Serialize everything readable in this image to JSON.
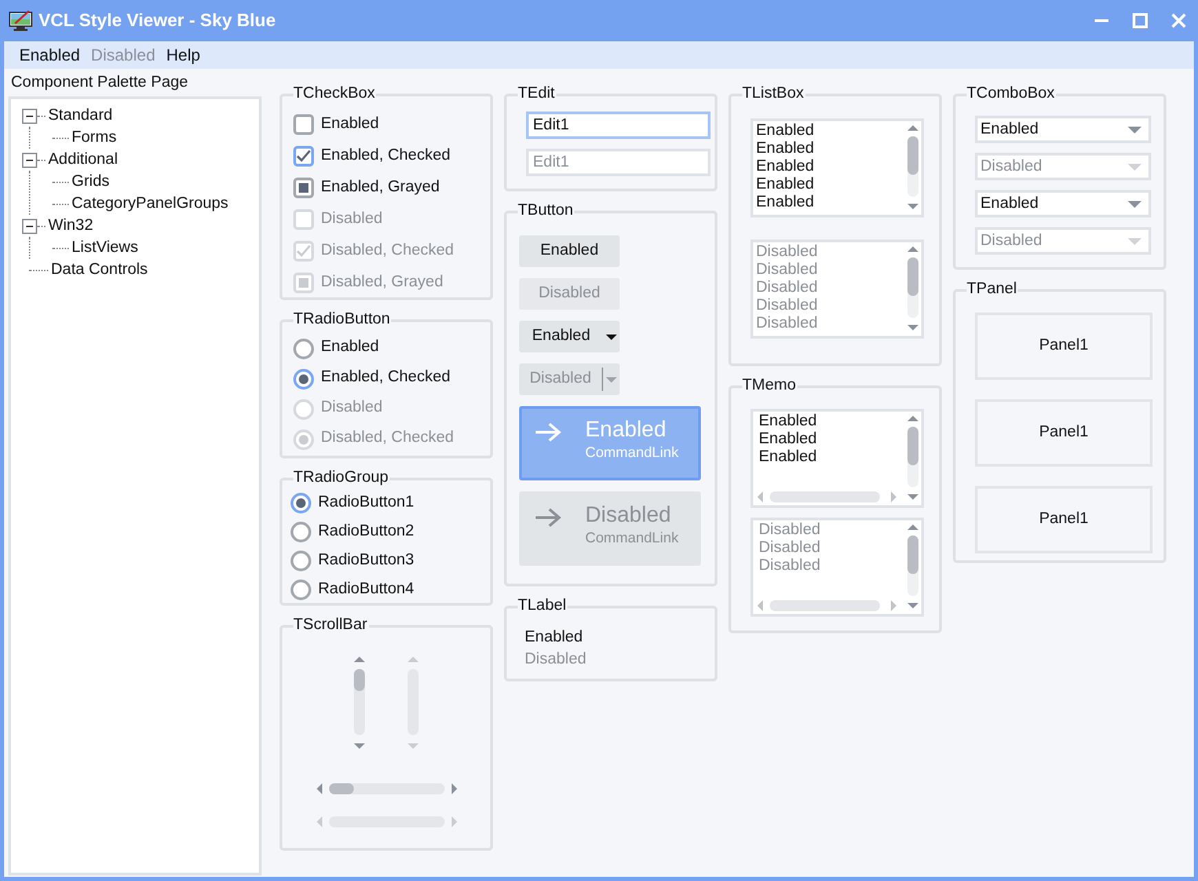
{
  "window": {
    "title": "VCL Style Viewer - Sky Blue"
  },
  "menu": [
    {
      "label": "Enabled",
      "disabled": false
    },
    {
      "label": "Disabled",
      "disabled": true
    },
    {
      "label": "Help",
      "disabled": false
    }
  ],
  "palette": {
    "label": "Component Palette Page",
    "tree": [
      {
        "label": "Standard",
        "expanded": true,
        "children": [
          {
            "label": "Forms"
          }
        ]
      },
      {
        "label": "Additional",
        "expanded": true,
        "children": [
          {
            "label": "Grids"
          },
          {
            "label": "CategoryPanelGroups"
          }
        ]
      },
      {
        "label": "Win32",
        "expanded": true,
        "children": [
          {
            "label": "ListViews"
          }
        ]
      },
      {
        "label": "Data Controls"
      }
    ]
  },
  "checkbox_group": {
    "title": "TCheckBox",
    "items": [
      {
        "label": "Enabled",
        "checked": false,
        "grayed": false,
        "disabled": false
      },
      {
        "label": "Enabled, Checked",
        "checked": true,
        "grayed": false,
        "disabled": false
      },
      {
        "label": "Enabled, Grayed",
        "checked": false,
        "grayed": true,
        "disabled": false
      },
      {
        "label": "Disabled",
        "checked": false,
        "grayed": false,
        "disabled": true
      },
      {
        "label": "Disabled, Checked",
        "checked": true,
        "grayed": false,
        "disabled": true
      },
      {
        "label": "Disabled, Grayed",
        "checked": false,
        "grayed": true,
        "disabled": true
      }
    ]
  },
  "radiobutton_group": {
    "title": "TRadioButton",
    "items": [
      {
        "label": "Enabled",
        "checked": false,
        "disabled": false
      },
      {
        "label": "Enabled, Checked",
        "checked": true,
        "disabled": false
      },
      {
        "label": "Disabled",
        "checked": false,
        "disabled": true
      },
      {
        "label": "Disabled, Checked",
        "checked": true,
        "disabled": true
      }
    ]
  },
  "radio_group": {
    "title": "TRadioGroup",
    "items": [
      {
        "label": "RadioButton1",
        "selected": true
      },
      {
        "label": "RadioButton2",
        "selected": false
      },
      {
        "label": "RadioButton3",
        "selected": false
      },
      {
        "label": "RadioButton4",
        "selected": false
      }
    ]
  },
  "scrollbar_group": {
    "title": "TScrollBar",
    "bars": [
      {
        "kind": "vertical",
        "disabled": false
      },
      {
        "kind": "vertical",
        "disabled": true
      },
      {
        "kind": "horizontal",
        "disabled": false
      },
      {
        "kind": "horizontal",
        "disabled": true
      }
    ]
  },
  "edit_group": {
    "title": "TEdit",
    "fields": [
      {
        "value": "Edit1",
        "disabled": false,
        "focused": true
      },
      {
        "value": "Edit1",
        "disabled": true,
        "focused": false
      }
    ]
  },
  "button_group": {
    "title": "TButton",
    "items": [
      {
        "kind": "push",
        "label": "Enabled",
        "disabled": false
      },
      {
        "kind": "push",
        "label": "Disabled",
        "disabled": true
      },
      {
        "kind": "split",
        "label": "Enabled",
        "disabled": false
      },
      {
        "kind": "split",
        "label": "Disabled",
        "disabled": true
      },
      {
        "kind": "commandlink",
        "label": "Enabled",
        "note": "CommandLink",
        "disabled": false
      },
      {
        "kind": "commandlink",
        "label": "Disabled",
        "note": "CommandLink",
        "disabled": true
      }
    ]
  },
  "label_group": {
    "title": "TLabel",
    "items": [
      {
        "text": "Enabled",
        "disabled": false
      },
      {
        "text": "Disabled",
        "disabled": true
      }
    ]
  },
  "listbox_group": {
    "title": "TListBox",
    "lists": [
      {
        "disabled": false,
        "items": [
          "Enabled",
          "Enabled",
          "Enabled",
          "Enabled",
          "Enabled"
        ]
      },
      {
        "disabled": true,
        "items": [
          "Disabled",
          "Disabled",
          "Disabled",
          "Disabled",
          "Disabled"
        ]
      }
    ]
  },
  "memo_group": {
    "title": "TMemo",
    "memos": [
      {
        "disabled": false,
        "lines": [
          "Enabled",
          "Enabled",
          "Enabled"
        ]
      },
      {
        "disabled": true,
        "lines": [
          "Disabled",
          "Disabled",
          "Disabled"
        ]
      }
    ]
  },
  "combobox_group": {
    "title": "TComboBox",
    "items": [
      {
        "value": "Enabled",
        "disabled": false
      },
      {
        "value": "Disabled",
        "disabled": true
      },
      {
        "value": "Enabled",
        "disabled": false
      },
      {
        "value": "Disabled",
        "disabled": true
      }
    ]
  },
  "panel_group": {
    "title": "TPanel",
    "panels": [
      "Panel1",
      "Panel1",
      "Panel1"
    ]
  }
}
